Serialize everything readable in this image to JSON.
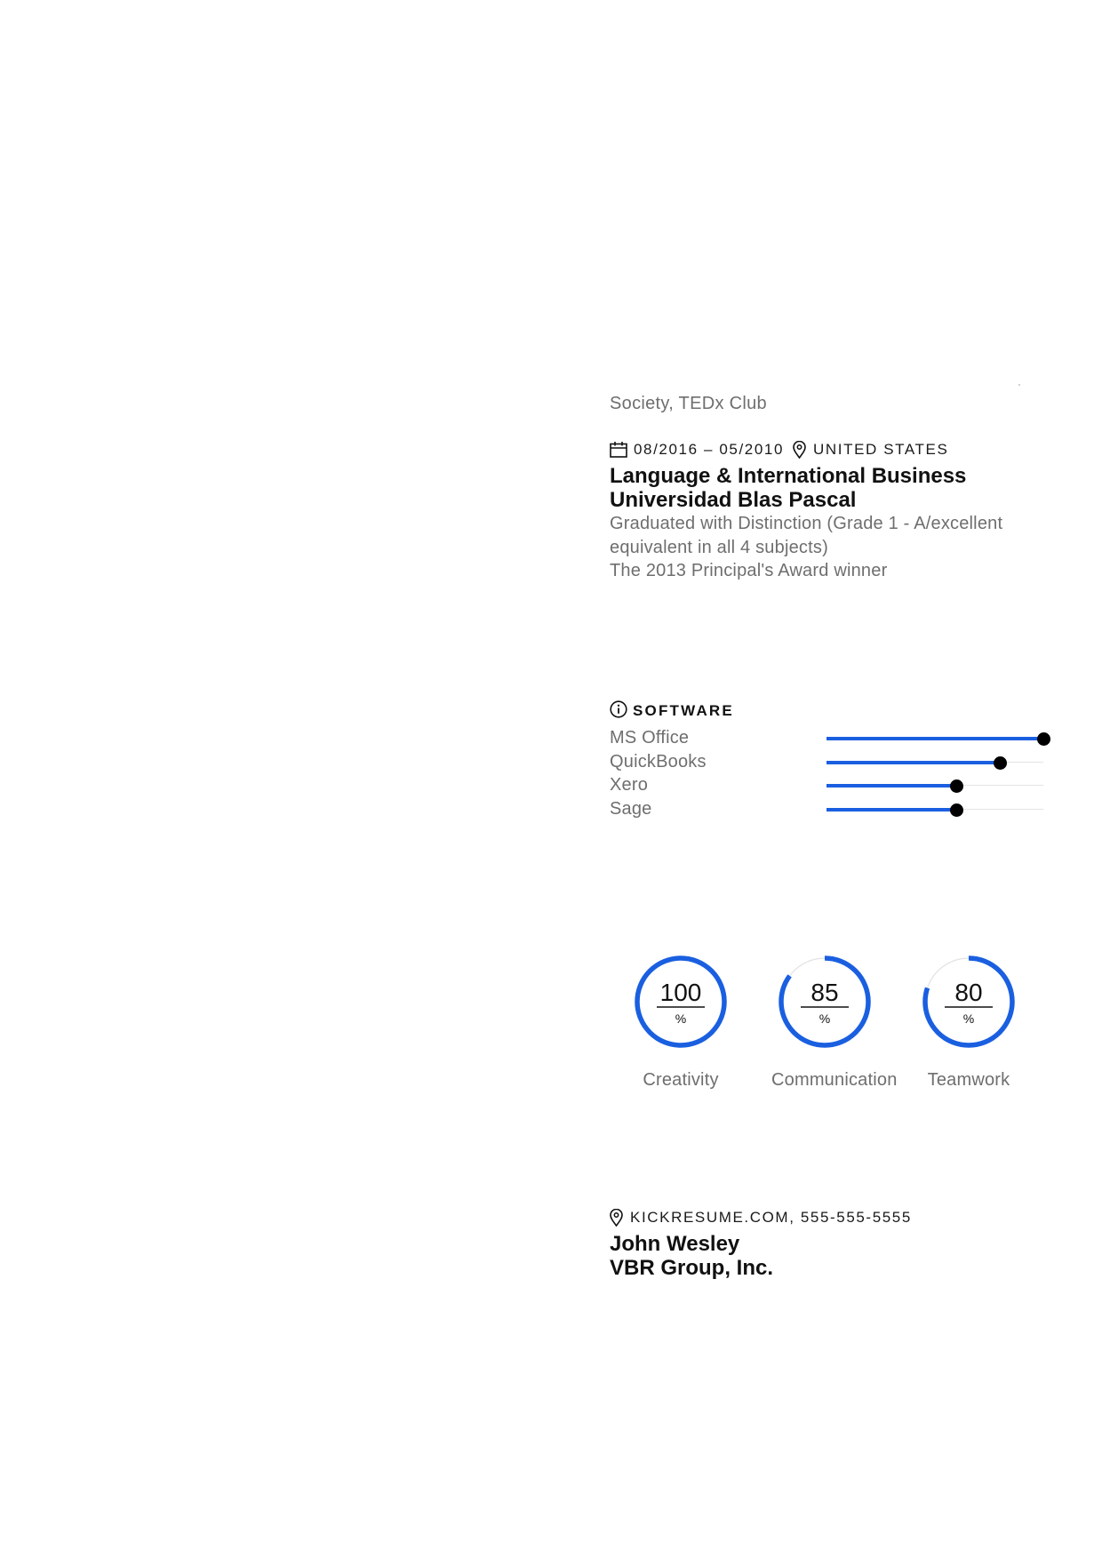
{
  "activities_tail": "Society, TEDx Club",
  "education": {
    "dates": "08/2016 – 05/2010",
    "location": "UNITED STATES",
    "degree": "Language & International Business",
    "school": "Universidad Blas Pascal",
    "lines": [
      "Graduated with Distinction (Grade 1 - A/excellent",
      "equivalent in all 4 subjects)",
      "The 2013 Principal's Award winner"
    ]
  },
  "software": {
    "heading": "SOFTWARE",
    "items": [
      {
        "label": "MS Office",
        "level": 1.0
      },
      {
        "label": "QuickBooks",
        "level": 0.8
      },
      {
        "label": "Xero",
        "level": 0.6
      },
      {
        "label": "Sage",
        "level": 0.6
      }
    ]
  },
  "skills": [
    {
      "value": "100",
      "unit": "%",
      "label": "Creativity",
      "percent": 100
    },
    {
      "value": "85",
      "unit": "%",
      "label": "Communication",
      "percent": 85
    },
    {
      "value": "80",
      "unit": "%",
      "label": "Teamwork",
      "percent": 80
    }
  ],
  "reference": {
    "contact": "KICKRESUME.COM, 555-555-5555",
    "name": "John Wesley",
    "company": "VBR Group, Inc."
  },
  "colors": {
    "accent": "#1a5fe0",
    "knob": "#000000",
    "muted_text": "#6e6e6e"
  }
}
